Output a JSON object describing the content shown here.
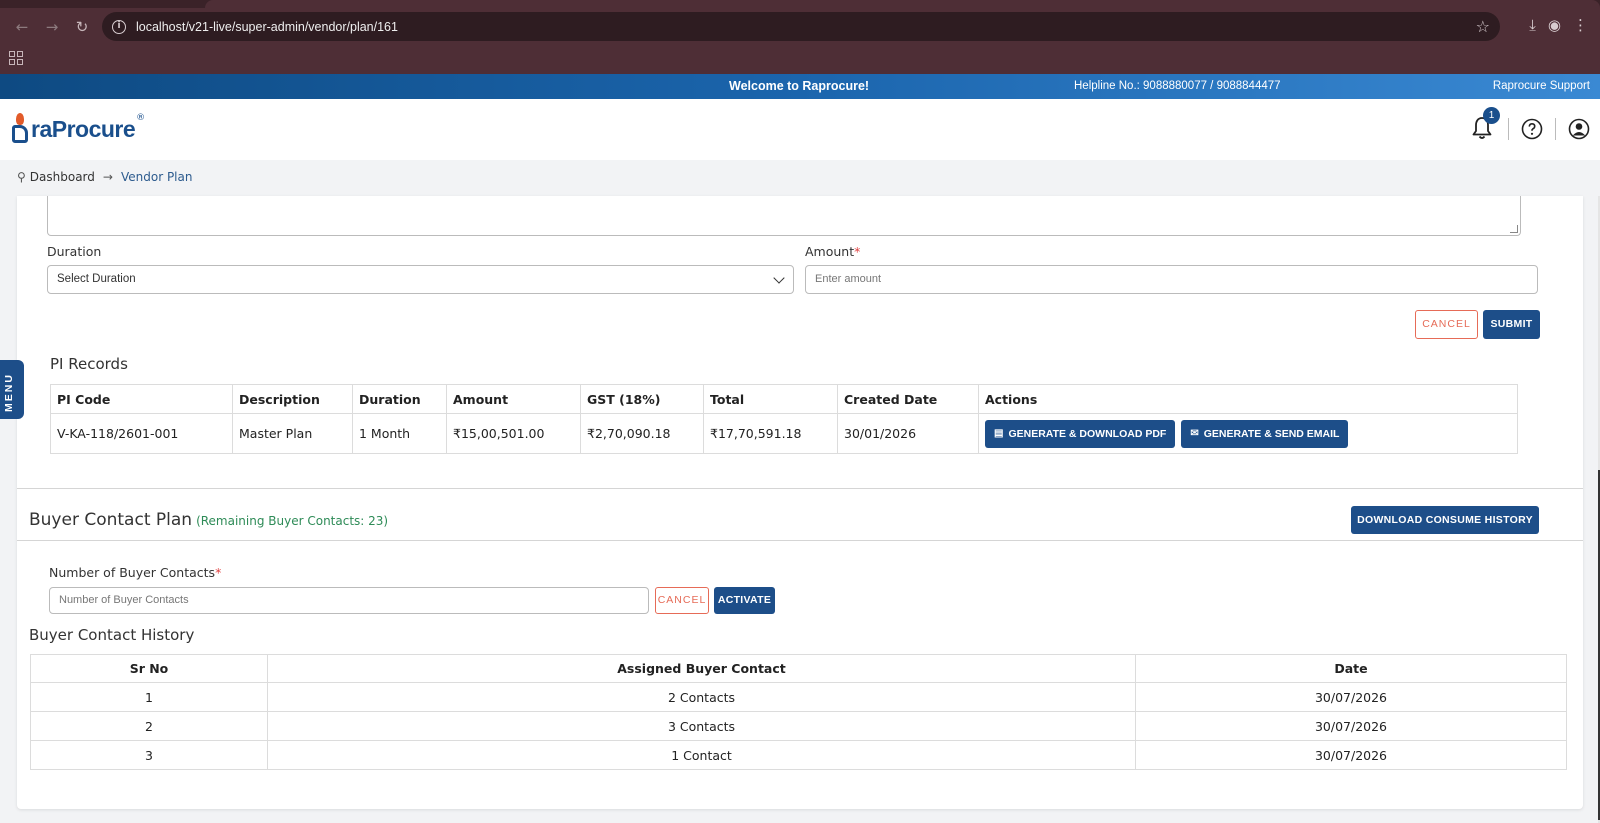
{
  "browser": {
    "url": "localhost/v21-live/super-admin/vendor/plan/161"
  },
  "topbar": {
    "welcome": "Welcome to Raprocure!",
    "helpline": "Helpline No.: 9088880077 / 9088844477",
    "support": "Raprocure Support"
  },
  "header": {
    "logo_text": "raProcure",
    "logo_reg": "®",
    "notification_count": "1"
  },
  "breadcrumb": {
    "home": "Dashboard",
    "current": "Vendor Plan"
  },
  "form": {
    "duration_label": "Duration",
    "duration_value": "Select Duration",
    "amount_label": "Amount",
    "amount_required": "*",
    "amount_placeholder": "Enter amount",
    "cancel_label": "CANCEL",
    "submit_label": "SUBMIT"
  },
  "pi_records": {
    "title": "PI Records",
    "columns": [
      "PI Code",
      "Description",
      "Duration",
      "Amount",
      "GST (18%)",
      "Total",
      "Created Date",
      "Actions"
    ],
    "rows": [
      {
        "pi_code": "V-KA-118/2601-001",
        "description": "Master Plan",
        "duration": "1 Month",
        "amount": "₹15,00,501.00",
        "gst": "₹2,70,090.18",
        "total": "₹17,70,591.18",
        "created_date": "30/01/2026",
        "action_pdf": "GENERATE & DOWNLOAD PDF",
        "action_email": "GENERATE & SEND EMAIL"
      }
    ]
  },
  "buyer_contact_plan": {
    "title": "Buyer Contact Plan",
    "remaining": "(Remaining Buyer Contacts: 23)",
    "download_label": "DOWNLOAD CONSUME HISTORY",
    "field_label": "Number of Buyer Contacts",
    "field_required": "*",
    "field_placeholder": "Number of Buyer Contacts",
    "cancel_label": "CANCEL",
    "activate_label": "ACTIVATE"
  },
  "buyer_contact_history": {
    "title": "Buyer Contact History",
    "columns": [
      "Sr No",
      "Assigned Buyer Contact",
      "Date"
    ],
    "rows": [
      {
        "sr": "1",
        "assigned": "2 Contacts",
        "date": "30/07/2026"
      },
      {
        "sr": "2",
        "assigned": "3 Contacts",
        "date": "30/07/2026"
      },
      {
        "sr": "3",
        "assigned": "1 Contact",
        "date": "30/07/2026"
      }
    ]
  },
  "side_menu": {
    "label": "MENU"
  },
  "colors": {
    "primary": "#1d4e89",
    "cancel": "#e66b57",
    "remaining": "#2e8b57"
  }
}
